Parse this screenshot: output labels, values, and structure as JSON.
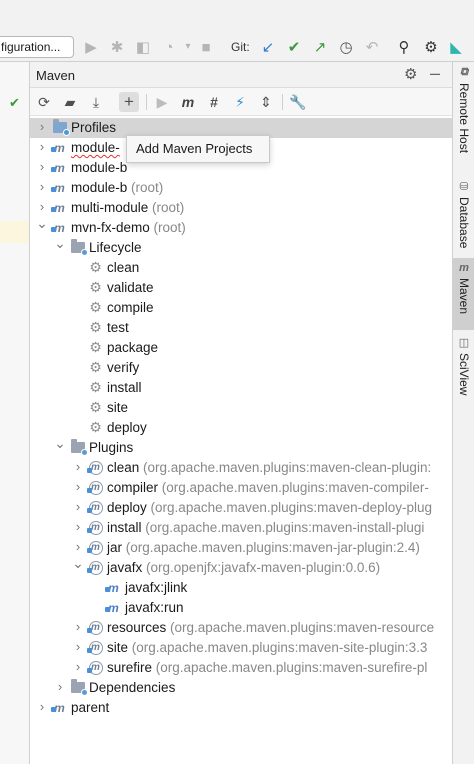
{
  "toolbar": {
    "config_label": "figuration...",
    "git_label": "Git:",
    "icons": [
      "run-icon",
      "debug-icon",
      "coverage-icon",
      "profile-icon",
      "stop-icon",
      "git-update-icon",
      "git-commit-icon",
      "git-push-icon",
      "history-icon",
      "rollback-icon",
      "search-icon",
      "settings-icon",
      "plugin-icon"
    ]
  },
  "panel": {
    "title": "Maven",
    "toolbar_icons": [
      "reload-icon",
      "generate-sources-icon",
      "download-icon",
      "add-icon",
      "run-icon",
      "execute-goal-icon",
      "toggle-offline-icon",
      "skip-tests-icon",
      "show-dependencies-icon",
      "collapse-all-icon",
      "settings-wrench-icon"
    ]
  },
  "tooltip": "Add Maven Projects",
  "tree": [
    {
      "label": "Profiles",
      "detail": "",
      "icon": "profiles-icon",
      "chevron": "right"
    },
    {
      "label": "module-",
      "detail": "",
      "icon": "maven-module-icon",
      "chevron": "right"
    },
    {
      "label": "module-b",
      "detail": "",
      "icon": "maven-module-icon",
      "chevron": "right"
    },
    {
      "label": "module-b",
      "detail": "(root)",
      "icon": "maven-module-icon",
      "chevron": "right"
    },
    {
      "label": "multi-module",
      "detail": "(root)",
      "icon": "maven-module-icon",
      "chevron": "right"
    },
    {
      "label": "mvn-fx-demo",
      "detail": "(root)",
      "icon": "maven-module-icon",
      "chevron": "down"
    },
    {
      "label": "Lifecycle",
      "detail": "",
      "icon": "lifecycle-folder-icon",
      "chevron": "down"
    },
    {
      "label": "clean",
      "detail": "",
      "icon": "gear-icon",
      "chevron": ""
    },
    {
      "label": "validate",
      "detail": "",
      "icon": "gear-icon",
      "chevron": ""
    },
    {
      "label": "compile",
      "detail": "",
      "icon": "gear-icon",
      "chevron": ""
    },
    {
      "label": "test",
      "detail": "",
      "icon": "gear-icon",
      "chevron": ""
    },
    {
      "label": "package",
      "detail": "",
      "icon": "gear-icon",
      "chevron": ""
    },
    {
      "label": "verify",
      "detail": "",
      "icon": "gear-icon",
      "chevron": ""
    },
    {
      "label": "install",
      "detail": "",
      "icon": "gear-icon",
      "chevron": ""
    },
    {
      "label": "site",
      "detail": "",
      "icon": "gear-icon",
      "chevron": ""
    },
    {
      "label": "deploy",
      "detail": "",
      "icon": "gear-icon",
      "chevron": ""
    },
    {
      "label": "Plugins",
      "detail": "",
      "icon": "plugins-folder-icon",
      "chevron": "down"
    },
    {
      "label": "clean",
      "detail": "(org.apache.maven.plugins:maven-clean-plugin:",
      "icon": "maven-plugin-icon",
      "chevron": "right"
    },
    {
      "label": "compiler",
      "detail": "(org.apache.maven.plugins:maven-compiler-",
      "icon": "maven-plugin-icon",
      "chevron": "right"
    },
    {
      "label": "deploy",
      "detail": "(org.apache.maven.plugins:maven-deploy-plug",
      "icon": "maven-plugin-icon",
      "chevron": "right"
    },
    {
      "label": "install",
      "detail": "(org.apache.maven.plugins:maven-install-plugi",
      "icon": "maven-plugin-icon",
      "chevron": "right"
    },
    {
      "label": "jar",
      "detail": "(org.apache.maven.plugins:maven-jar-plugin:2.4)",
      "icon": "maven-plugin-icon",
      "chevron": "right"
    },
    {
      "label": "javafx",
      "detail": "(org.openjfx:javafx-maven-plugin:0.0.6)",
      "icon": "maven-plugin-icon",
      "chevron": "down"
    },
    {
      "label": "javafx:jlink",
      "detail": "",
      "icon": "maven-goal-icon",
      "chevron": ""
    },
    {
      "label": "javafx:run",
      "detail": "",
      "icon": "maven-goal-icon",
      "chevron": ""
    },
    {
      "label": "resources",
      "detail": "(org.apache.maven.plugins:maven-resource",
      "icon": "maven-plugin-icon",
      "chevron": "right"
    },
    {
      "label": "site",
      "detail": "(org.apache.maven.plugins:maven-site-plugin:3.3",
      "icon": "maven-plugin-icon",
      "chevron": "right"
    },
    {
      "label": "surefire",
      "detail": "(org.apache.maven.plugins:maven-surefire-pl",
      "icon": "maven-plugin-icon",
      "chevron": "right"
    },
    {
      "label": "Dependencies",
      "detail": "",
      "icon": "dependencies-folder-icon",
      "chevron": "right"
    },
    {
      "label": "parent",
      "detail": "",
      "icon": "maven-module-icon",
      "chevron": "right"
    }
  ],
  "right_tabs": [
    {
      "label": "Remote Host",
      "icon": "remote-host-icon"
    },
    {
      "label": "Database",
      "icon": "database-icon"
    },
    {
      "label": "Maven",
      "icon": "maven-tab-icon"
    },
    {
      "label": "SciView",
      "icon": "sciview-icon"
    }
  ],
  "colors": {
    "selected_row": "#d5d5d5",
    "detail_text": "#888888",
    "git_green": "#3a9a3a",
    "git_blue": "#2f7fd1"
  }
}
